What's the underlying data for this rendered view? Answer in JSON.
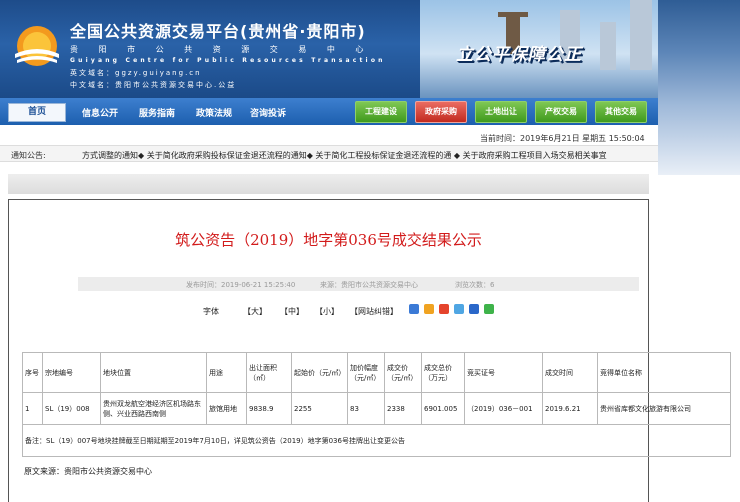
{
  "header": {
    "title": "全国公共资源交易平台(贵州省·贵阳市)",
    "subtitle": "贵 阳 市 公 共 资 源 交 易 中 心",
    "english": "Guiyang Centre for Public Resources Transaction",
    "domain_en": "英文域名：ggzy.guiyang.cn",
    "domain_cn": "中文域名：贵阳市公共资源交易中心.公益",
    "slogan": "立公平保障公正"
  },
  "nav": {
    "home": "首页",
    "items": [
      "信息公开",
      "服务指南",
      "政策法规",
      "咨询投诉"
    ],
    "buttons": [
      "工程建设",
      "政府采购",
      "土地出让",
      "产权交易",
      "其他交易"
    ]
  },
  "datetime": "当前时间：2019年6月21日 星期五 15:50:04",
  "notice": {
    "label": "通知公告:",
    "text": "方式调整的通知◆ 关于简化政府采购投标保证金退还流程的通知◆ 关于简化工程投标保证金退还流程的通 ◆ 关于政府采购工程项目入场交易相关事宜"
  },
  "article": {
    "title": "筑公资告（2019）地字第036号成交结果公示",
    "publish_time": "发布时间：2019-06-21 15:25:40",
    "source_meta": "来源：贵阳市公共资源交易中心",
    "views": "浏览次数：6",
    "font_label": "字体",
    "font_large": "【大】",
    "font_mid": "【中】",
    "font_small": "【小】",
    "error_fix": "【网站纠错】"
  },
  "table": {
    "headers": [
      "序号",
      "宗地编号",
      "地块位置",
      "用途",
      "出让面积（㎡）",
      "起始价（元/㎡）",
      "加价幅度（元/㎡）",
      "成交价（元/㎡）",
      "成交总价（万元）",
      "竞买证号",
      "成交时间",
      "竞得单位名称"
    ],
    "row": [
      "1",
      "SL（19）008",
      "贵州双龙航空港经济区机场路东侧、兴业西路西南侧",
      "旅馆用地",
      "9838.9",
      "2255",
      "83",
      "2338",
      "6901.005",
      "（2019）036－001",
      "2019.6.21",
      "贵州省库都文化旅游有限公司"
    ],
    "note": "备注：SL（19）007号地块挂牌截至日期延期至2019年7月10日，详见筑公资告（2019）地字第036号挂牌出让变更公告"
  },
  "source_footer": "原文来源：贵阳市公共资源交易中心",
  "colors": {
    "title_red": "#d21b1b",
    "nav_blue": "#1d5fae",
    "btn_green": "#3f9a1d",
    "btn_red": "#c22a1f"
  }
}
